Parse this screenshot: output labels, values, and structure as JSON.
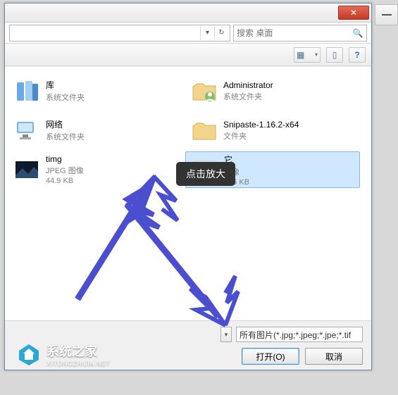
{
  "titlebar": {
    "close_glyph": "✕"
  },
  "address": {
    "dropdown_glyph": "▾",
    "refresh_glyph": "↻"
  },
  "search": {
    "placeholder": "搜索 桌面",
    "icon_glyph": "🔍"
  },
  "toolbar": {
    "view_glyph": "▦",
    "view_dd": "▾",
    "panel_glyph": "▯",
    "help_glyph": "?"
  },
  "items": {
    "libs": {
      "name": "库",
      "sub1": "系统文件夹"
    },
    "net": {
      "name": "网络",
      "sub1": "系统文件夹"
    },
    "timg": {
      "name": "timg",
      "sub1": "JPEG 图像",
      "sub2": "44.9 KB"
    },
    "admin": {
      "name": "Administrator",
      "sub1": "系统文件夹"
    },
    "snip": {
      "name": "Snipaste-1.16.2-x64",
      "sub1": "文件夹"
    },
    "sel": {
      "name": "它",
      "sub1": "图像",
      "sub2": "106 KB"
    }
  },
  "filetype": {
    "label": "所有图片(*.jpg;*.jpeg;*.jpe;*.tif"
  },
  "buttons": {
    "open": "打开(O)",
    "cancel": "取消"
  },
  "tooltip": {
    "text": "点击放大"
  },
  "watermark": {
    "title": "系统之家",
    "sub": "XITONGZHIJIA.NET"
  }
}
